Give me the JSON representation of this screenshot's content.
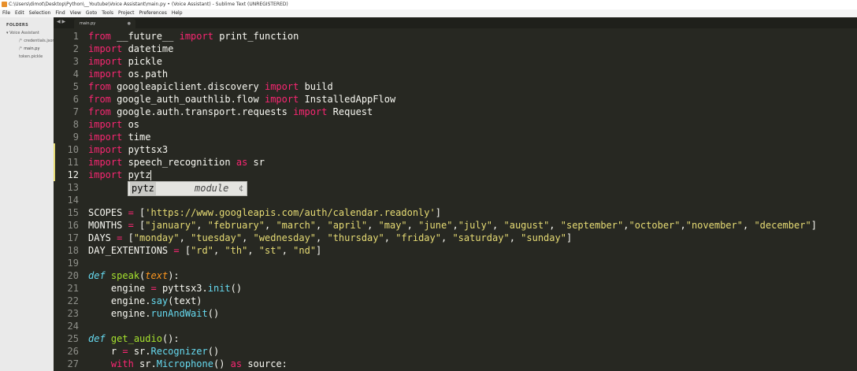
{
  "window": {
    "title": "C:\\Users\\dimot\\Desktop\\Python\\__Youtube\\Voice Assistant\\main.py • (Voice Assistant) - Sublime Text (UNREGISTERED)"
  },
  "menu": [
    "File",
    "Edit",
    "Selection",
    "Find",
    "View",
    "Goto",
    "Tools",
    "Project",
    "Preferences",
    "Help"
  ],
  "sidebar": {
    "header": "FOLDERS",
    "folder": "Voice Assistant",
    "files": [
      {
        "name": "credentials.json",
        "icon": "/*"
      },
      {
        "name": "main.py",
        "icon": "/*"
      },
      {
        "name": "token.pickle",
        "icon": ""
      }
    ]
  },
  "tabs": [
    {
      "label": "main.py",
      "close": "●"
    }
  ],
  "nav_arrows": "◀ ▶",
  "autocomplete": {
    "name": "pytz",
    "kind": "module",
    "icon": "¢"
  },
  "editor": {
    "current_line": 12,
    "modified_lines": [
      10,
      11,
      12
    ],
    "lines": [
      {
        "n": "1",
        "tokens": [
          {
            "t": "from",
            "c": "k"
          },
          {
            "t": " __future__ "
          },
          {
            "t": "import",
            "c": "k"
          },
          {
            "t": " print_function"
          }
        ]
      },
      {
        "n": "2",
        "tokens": [
          {
            "t": "import",
            "c": "k"
          },
          {
            "t": " datetime"
          }
        ]
      },
      {
        "n": "3",
        "tokens": [
          {
            "t": "import",
            "c": "k"
          },
          {
            "t": " pickle"
          }
        ]
      },
      {
        "n": "4",
        "tokens": [
          {
            "t": "import",
            "c": "k"
          },
          {
            "t": " os.path"
          }
        ]
      },
      {
        "n": "5",
        "tokens": [
          {
            "t": "from",
            "c": "k"
          },
          {
            "t": " googleapiclient.discovery "
          },
          {
            "t": "import",
            "c": "k"
          },
          {
            "t": " build"
          }
        ]
      },
      {
        "n": "6",
        "tokens": [
          {
            "t": "from",
            "c": "k"
          },
          {
            "t": " google_auth_oauthlib.flow "
          },
          {
            "t": "import",
            "c": "k"
          },
          {
            "t": " InstalledAppFlow"
          }
        ]
      },
      {
        "n": "7",
        "tokens": [
          {
            "t": "from",
            "c": "k"
          },
          {
            "t": " google.auth.transport.requests "
          },
          {
            "t": "import",
            "c": "k"
          },
          {
            "t": " Request"
          }
        ]
      },
      {
        "n": "8",
        "tokens": [
          {
            "t": "import",
            "c": "k"
          },
          {
            "t": " os"
          }
        ]
      },
      {
        "n": "9",
        "tokens": [
          {
            "t": "import",
            "c": "k"
          },
          {
            "t": " time"
          }
        ]
      },
      {
        "n": "10",
        "tokens": [
          {
            "t": "import",
            "c": "k"
          },
          {
            "t": " pyttsx3"
          }
        ]
      },
      {
        "n": "11",
        "tokens": [
          {
            "t": "import",
            "c": "k"
          },
          {
            "t": " speech_recognition "
          },
          {
            "t": "as",
            "c": "k"
          },
          {
            "t": " sr"
          }
        ]
      },
      {
        "n": "12",
        "tokens": [
          {
            "t": "import",
            "c": "k"
          },
          {
            "t": " pytz"
          }
        ]
      },
      {
        "n": "13",
        "tokens": []
      },
      {
        "n": "14",
        "tokens": []
      },
      {
        "n": "15",
        "tokens": [
          {
            "t": "SCOPES "
          },
          {
            "t": "=",
            "c": "k"
          },
          {
            "t": " ["
          },
          {
            "t": "'https://www.googleapis.com/auth/calendar.readonly'",
            "c": "s"
          },
          {
            "t": "]"
          }
        ]
      },
      {
        "n": "16",
        "tokens": [
          {
            "t": "MONTHS "
          },
          {
            "t": "=",
            "c": "k"
          },
          {
            "t": " ["
          },
          {
            "t": "\"january\"",
            "c": "s"
          },
          {
            "t": ", "
          },
          {
            "t": "\"february\"",
            "c": "s"
          },
          {
            "t": ", "
          },
          {
            "t": "\"march\"",
            "c": "s"
          },
          {
            "t": ", "
          },
          {
            "t": "\"april\"",
            "c": "s"
          },
          {
            "t": ", "
          },
          {
            "t": "\"may\"",
            "c": "s"
          },
          {
            "t": ", "
          },
          {
            "t": "\"june\"",
            "c": "s"
          },
          {
            "t": ","
          },
          {
            "t": "\"july\"",
            "c": "s"
          },
          {
            "t": ", "
          },
          {
            "t": "\"august\"",
            "c": "s"
          },
          {
            "t": ", "
          },
          {
            "t": "\"september\"",
            "c": "s"
          },
          {
            "t": ","
          },
          {
            "t": "\"october\"",
            "c": "s"
          },
          {
            "t": ","
          },
          {
            "t": "\"november\"",
            "c": "s"
          },
          {
            "t": ", "
          },
          {
            "t": "\"december\"",
            "c": "s"
          },
          {
            "t": "]"
          }
        ]
      },
      {
        "n": "17",
        "tokens": [
          {
            "t": "DAYS "
          },
          {
            "t": "=",
            "c": "k"
          },
          {
            "t": " ["
          },
          {
            "t": "\"monday\"",
            "c": "s"
          },
          {
            "t": ", "
          },
          {
            "t": "\"tuesday\"",
            "c": "s"
          },
          {
            "t": ", "
          },
          {
            "t": "\"wednesday\"",
            "c": "s"
          },
          {
            "t": ", "
          },
          {
            "t": "\"thursday\"",
            "c": "s"
          },
          {
            "t": ", "
          },
          {
            "t": "\"friday\"",
            "c": "s"
          },
          {
            "t": ", "
          },
          {
            "t": "\"saturday\"",
            "c": "s"
          },
          {
            "t": ", "
          },
          {
            "t": "\"sunday\"",
            "c": "s"
          },
          {
            "t": "]"
          }
        ]
      },
      {
        "n": "18",
        "tokens": [
          {
            "t": "DAY_EXTENTIONS "
          },
          {
            "t": "=",
            "c": "k"
          },
          {
            "t": " ["
          },
          {
            "t": "\"rd\"",
            "c": "s"
          },
          {
            "t": ", "
          },
          {
            "t": "\"th\"",
            "c": "s"
          },
          {
            "t": ", "
          },
          {
            "t": "\"st\"",
            "c": "s"
          },
          {
            "t": ", "
          },
          {
            "t": "\"nd\"",
            "c": "s"
          },
          {
            "t": "]"
          }
        ]
      },
      {
        "n": "19",
        "tokens": []
      },
      {
        "n": "20",
        "tokens": [
          {
            "t": "def",
            "c": "c",
            "i": true
          },
          {
            "t": " "
          },
          {
            "t": "speak",
            "c": "f"
          },
          {
            "t": "("
          },
          {
            "t": "text",
            "c": "p",
            "i": true
          },
          {
            "t": "):"
          }
        ]
      },
      {
        "n": "21",
        "tokens": [
          {
            "t": "    engine "
          },
          {
            "t": "=",
            "c": "k"
          },
          {
            "t": " pyttsx3."
          },
          {
            "t": "init",
            "c": "c"
          },
          {
            "t": "()"
          }
        ]
      },
      {
        "n": "22",
        "tokens": [
          {
            "t": "    engine."
          },
          {
            "t": "say",
            "c": "c"
          },
          {
            "t": "(text)"
          }
        ]
      },
      {
        "n": "23",
        "tokens": [
          {
            "t": "    engine."
          },
          {
            "t": "runAndWait",
            "c": "c"
          },
          {
            "t": "()"
          }
        ]
      },
      {
        "n": "24",
        "tokens": []
      },
      {
        "n": "25",
        "tokens": [
          {
            "t": "def",
            "c": "c",
            "i": true
          },
          {
            "t": " "
          },
          {
            "t": "get_audio",
            "c": "f"
          },
          {
            "t": "():"
          }
        ]
      },
      {
        "n": "26",
        "tokens": [
          {
            "t": "    r "
          },
          {
            "t": "=",
            "c": "k"
          },
          {
            "t": " sr."
          },
          {
            "t": "Recognizer",
            "c": "c"
          },
          {
            "t": "()"
          }
        ]
      },
      {
        "n": "27",
        "tokens": [
          {
            "t": "    "
          },
          {
            "t": "with",
            "c": "k"
          },
          {
            "t": " sr."
          },
          {
            "t": "Microphone",
            "c": "c"
          },
          {
            "t": "() "
          },
          {
            "t": "as",
            "c": "k"
          },
          {
            "t": " source:"
          }
        ]
      }
    ]
  }
}
